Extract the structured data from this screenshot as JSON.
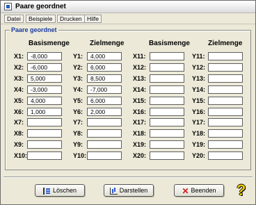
{
  "window": {
    "title": "Paare geordnet"
  },
  "menu": {
    "items": [
      "Datei",
      "Beispiele",
      "Drucken",
      "Hilfe"
    ]
  },
  "group": {
    "label": "Paare geordnet",
    "headers": {
      "left_basis": "Basismenge",
      "left_ziel": "Zielmenge",
      "right_basis": "Basismenge",
      "right_ziel": "Zielmenge"
    },
    "x_labels_left": [
      "X1:",
      "X2:",
      "X3:",
      "X4:",
      "X5:",
      "X6:",
      "X7:",
      "X8:",
      "X9:",
      "X10:"
    ],
    "y_labels_left": [
      "Y1:",
      "Y2:",
      "Y3:",
      "Y4:",
      "Y5:",
      "Y6:",
      "Y7:",
      "Y8:",
      "Y9:",
      "Y10:"
    ],
    "x_labels_right": [
      "X11:",
      "X12:",
      "X13:",
      "X14:",
      "X15:",
      "X16:",
      "X17:",
      "X18:",
      "X19:",
      "X20:"
    ],
    "y_labels_right": [
      "Y11:",
      "Y12:",
      "Y13:",
      "Y14:",
      "Y15:",
      "Y16:",
      "Y17:",
      "Y18:",
      "Y19:",
      "Y20:"
    ],
    "x_values_left": [
      "-8,000",
      "-6,000",
      "5,000",
      "-3,000",
      "4,000",
      "1,000",
      "",
      "",
      "",
      ""
    ],
    "y_values_left": [
      "4,000",
      "6,000",
      "8,500",
      "-7,000",
      "6,000",
      "2,000",
      "",
      "",
      "",
      ""
    ],
    "x_values_right": [
      "",
      "",
      "",
      "",
      "",
      "",
      "",
      "",
      "",
      ""
    ],
    "y_values_right": [
      "",
      "",
      "",
      "",
      "",
      "",
      "",
      "",
      "",
      ""
    ]
  },
  "buttons": {
    "loeschen": "Löschen",
    "darstellen": "Darstellen",
    "beenden": "Beenden"
  },
  "icons": {
    "help": "?",
    "beenden": "✕"
  }
}
